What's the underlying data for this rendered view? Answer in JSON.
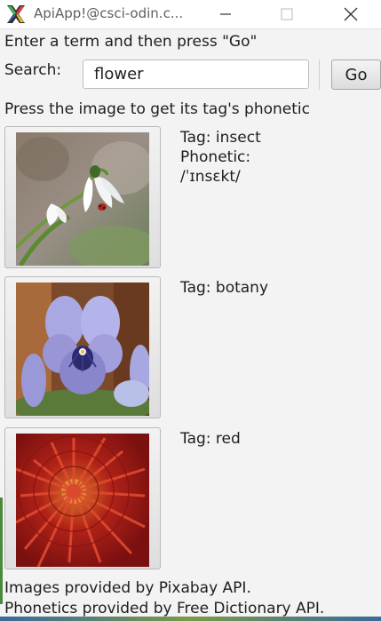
{
  "window": {
    "title": "ApiApp!@csci-odin.c...",
    "icon": "x-logo-icon",
    "controls": [
      "minimize-icon",
      "maximize-icon",
      "close-icon"
    ]
  },
  "prompt": "Enter a term and then press \"Go\"",
  "search": {
    "label": "Search:",
    "value": "flower",
    "button_label": "Go"
  },
  "instruction": "Press the image to get its tag's phonetic",
  "results": [
    {
      "image_subject": "snowdrop-with-ladybug",
      "tag_label": "Tag: insect",
      "phonetic_label": "Phonetic:",
      "phonetic_value": "/ˈɪnsɛkt/"
    },
    {
      "image_subject": "purple-pansies",
      "tag_label": "Tag: botany"
    },
    {
      "image_subject": "red-dahlia",
      "tag_label": "Tag: red"
    }
  ],
  "footer": {
    "line1": "Images provided by Pixabay API.",
    "line2": "Phonetics provided by Free Dictionary API."
  },
  "colors": {
    "background": "#f3f3f3",
    "titlebar": "#ffffff",
    "text": "#1e1e1e"
  }
}
